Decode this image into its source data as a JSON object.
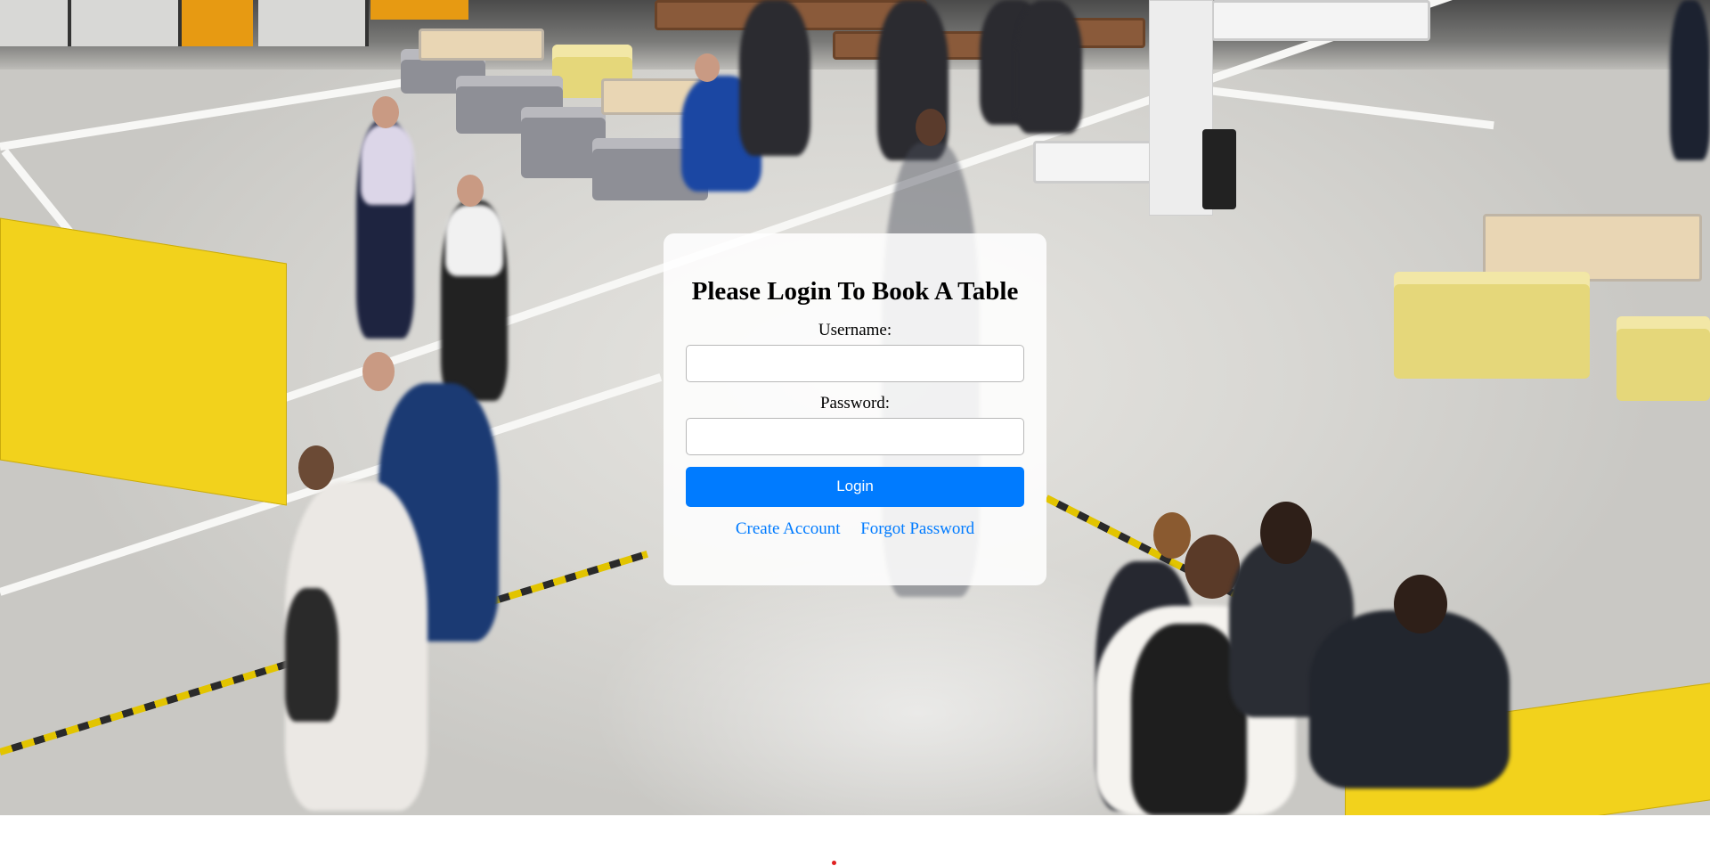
{
  "background": {
    "image_description_icon": "atrium-photo"
  },
  "login": {
    "title": "Please Login To Book A Table",
    "username_label": "Username:",
    "username_value": "",
    "password_label": "Password:",
    "password_value": "",
    "login_button": "Login",
    "create_account_link": "Create Account",
    "forgot_password_link": "Forgot Password"
  },
  "colors": {
    "primary": "#007bff",
    "card_background": "#ffffff",
    "indicator": "#e02020"
  }
}
